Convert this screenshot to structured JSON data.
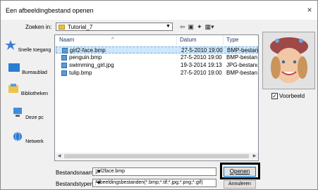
{
  "window": {
    "title": "Een afbeeldingbestand openen",
    "close": "×"
  },
  "lookin": {
    "label": "Zoeken in:",
    "value": "Tutorial_7"
  },
  "places": [
    {
      "label": "Snelle toegang",
      "icon": "star-icon"
    },
    {
      "label": "Bureaublad",
      "icon": "desktop-icon"
    },
    {
      "label": "Bibliotheken",
      "icon": "libraries-icon"
    },
    {
      "label": "Deze pc",
      "icon": "pc-icon"
    },
    {
      "label": "Netwerk",
      "icon": "network-icon"
    }
  ],
  "columns": {
    "name": "Naam",
    "date": "Datum",
    "type": "Type"
  },
  "files": [
    {
      "name": "girl2-face.bmp",
      "date": "27-5-2010 19:00",
      "type": "BMP-bestand",
      "selected": true
    },
    {
      "name": "penguin.bmp",
      "date": "27-5-2010 19:00",
      "type": "BMP-bestand",
      "selected": false
    },
    {
      "name": "swimming_girl.jpg",
      "date": "19-3-2014 19:13",
      "type": "JPG-bestand",
      "selected": false
    },
    {
      "name": "tulip.bmp",
      "date": "27-5-2010 19:00",
      "type": "BMP-bestand",
      "selected": false
    }
  ],
  "preview": {
    "checkbox_label": "Voorbeeld",
    "checked": true
  },
  "filename": {
    "label": "Bestandsnaam:",
    "value": "girl2face.bmp"
  },
  "filetype": {
    "label": "Bestandstypen:",
    "value": "Afbeeldingsbestanden(*.bmp;*.tif;*.jpg;*.png;*.gif)"
  },
  "buttons": {
    "open": "Openen",
    "cancel": "Annuleren"
  },
  "colors": {
    "accent": "#0078d7",
    "selection": "#cce8ff"
  }
}
